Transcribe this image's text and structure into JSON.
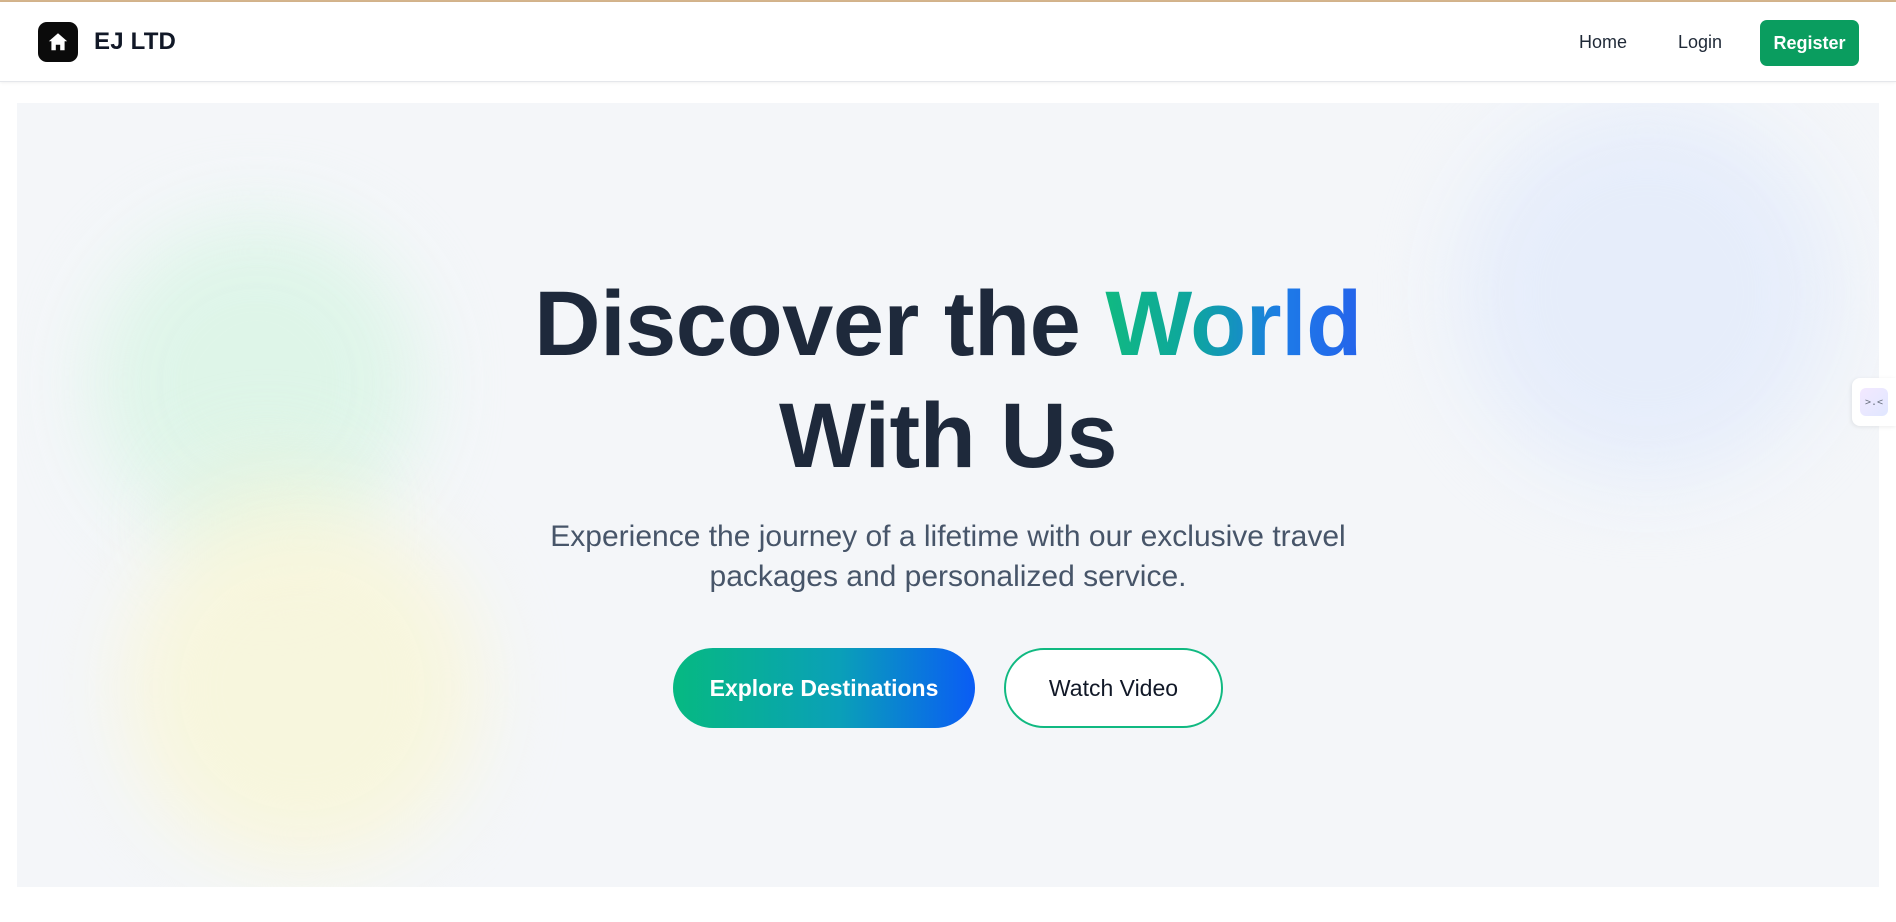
{
  "nav": {
    "brand": "EJ LTD",
    "brand_icon": "home-icon",
    "links": {
      "home": "Home",
      "login": "Login",
      "register": "Register"
    }
  },
  "hero": {
    "title_part1": "Discover the ",
    "title_accent": "World",
    "title_part2": "With Us",
    "subtitle": "Experience the journey of a lifetime with our exclusive travel packages and personalized service.",
    "primary_button": "Explore Destinations",
    "secondary_button": "Watch Video"
  },
  "side_widget": {
    "glyph": ">.<"
  },
  "colors": {
    "accent_green": "#0a9d5f",
    "gradient_start": "#06b981",
    "gradient_end": "#0a5cf5",
    "heading": "#1e293b",
    "hero_bg": "#f4f6f9"
  }
}
